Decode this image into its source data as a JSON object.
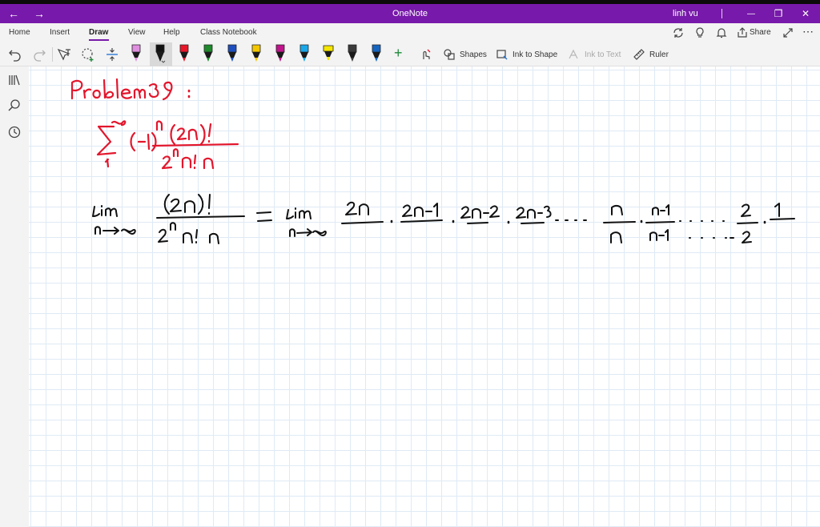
{
  "titlebar": {
    "app_title": "OneNote",
    "user_name": "linh vu",
    "back_glyph": "←",
    "forward_glyph": "→",
    "minimize_glyph": "—",
    "restore_glyph": "❐",
    "close_glyph": "✕",
    "bar_color": "#7719aa"
  },
  "ribbon": {
    "tabs": [
      {
        "label": "Home"
      },
      {
        "label": "Insert"
      },
      {
        "label": "Draw",
        "active": true
      },
      {
        "label": "View"
      },
      {
        "label": "Help"
      },
      {
        "label": "Class Notebook"
      }
    ],
    "share_label": "Share",
    "more_glyph": "⋯"
  },
  "toolbar": {
    "pens": [
      {
        "color": "#e08ee0",
        "icon": "pen-icon-pink"
      },
      {
        "color": "#111111",
        "icon": "pen-icon-black",
        "selected": true
      },
      {
        "color": "#e8182a",
        "icon": "pen-icon-red"
      },
      {
        "color": "#1f8a2c",
        "icon": "pen-icon-green"
      },
      {
        "color": "#1e4fbf",
        "icon": "pen-icon-blue"
      },
      {
        "color": "#f2c600",
        "icon": "pen-icon-yellow"
      },
      {
        "color": "#c0148c",
        "icon": "pen-icon-magenta"
      },
      {
        "color": "#1aa7e8",
        "icon": "pen-icon-cyan"
      },
      {
        "color": "#f5e600",
        "icon": "highlighter-icon-yellow"
      },
      {
        "color": "#3a3a3a",
        "icon": "pen-icon-gray"
      },
      {
        "color": "#1565c0",
        "icon": "pen-icon-darkblue"
      }
    ],
    "shapes_label": "Shapes",
    "ink_to_shape_label": "Ink to Shape",
    "ink_to_text_label": "Ink to Text",
    "ruler_label": "Ruler",
    "add_glyph": "+"
  },
  "ink": {
    "red": "#e3162c",
    "black": "#111111"
  }
}
